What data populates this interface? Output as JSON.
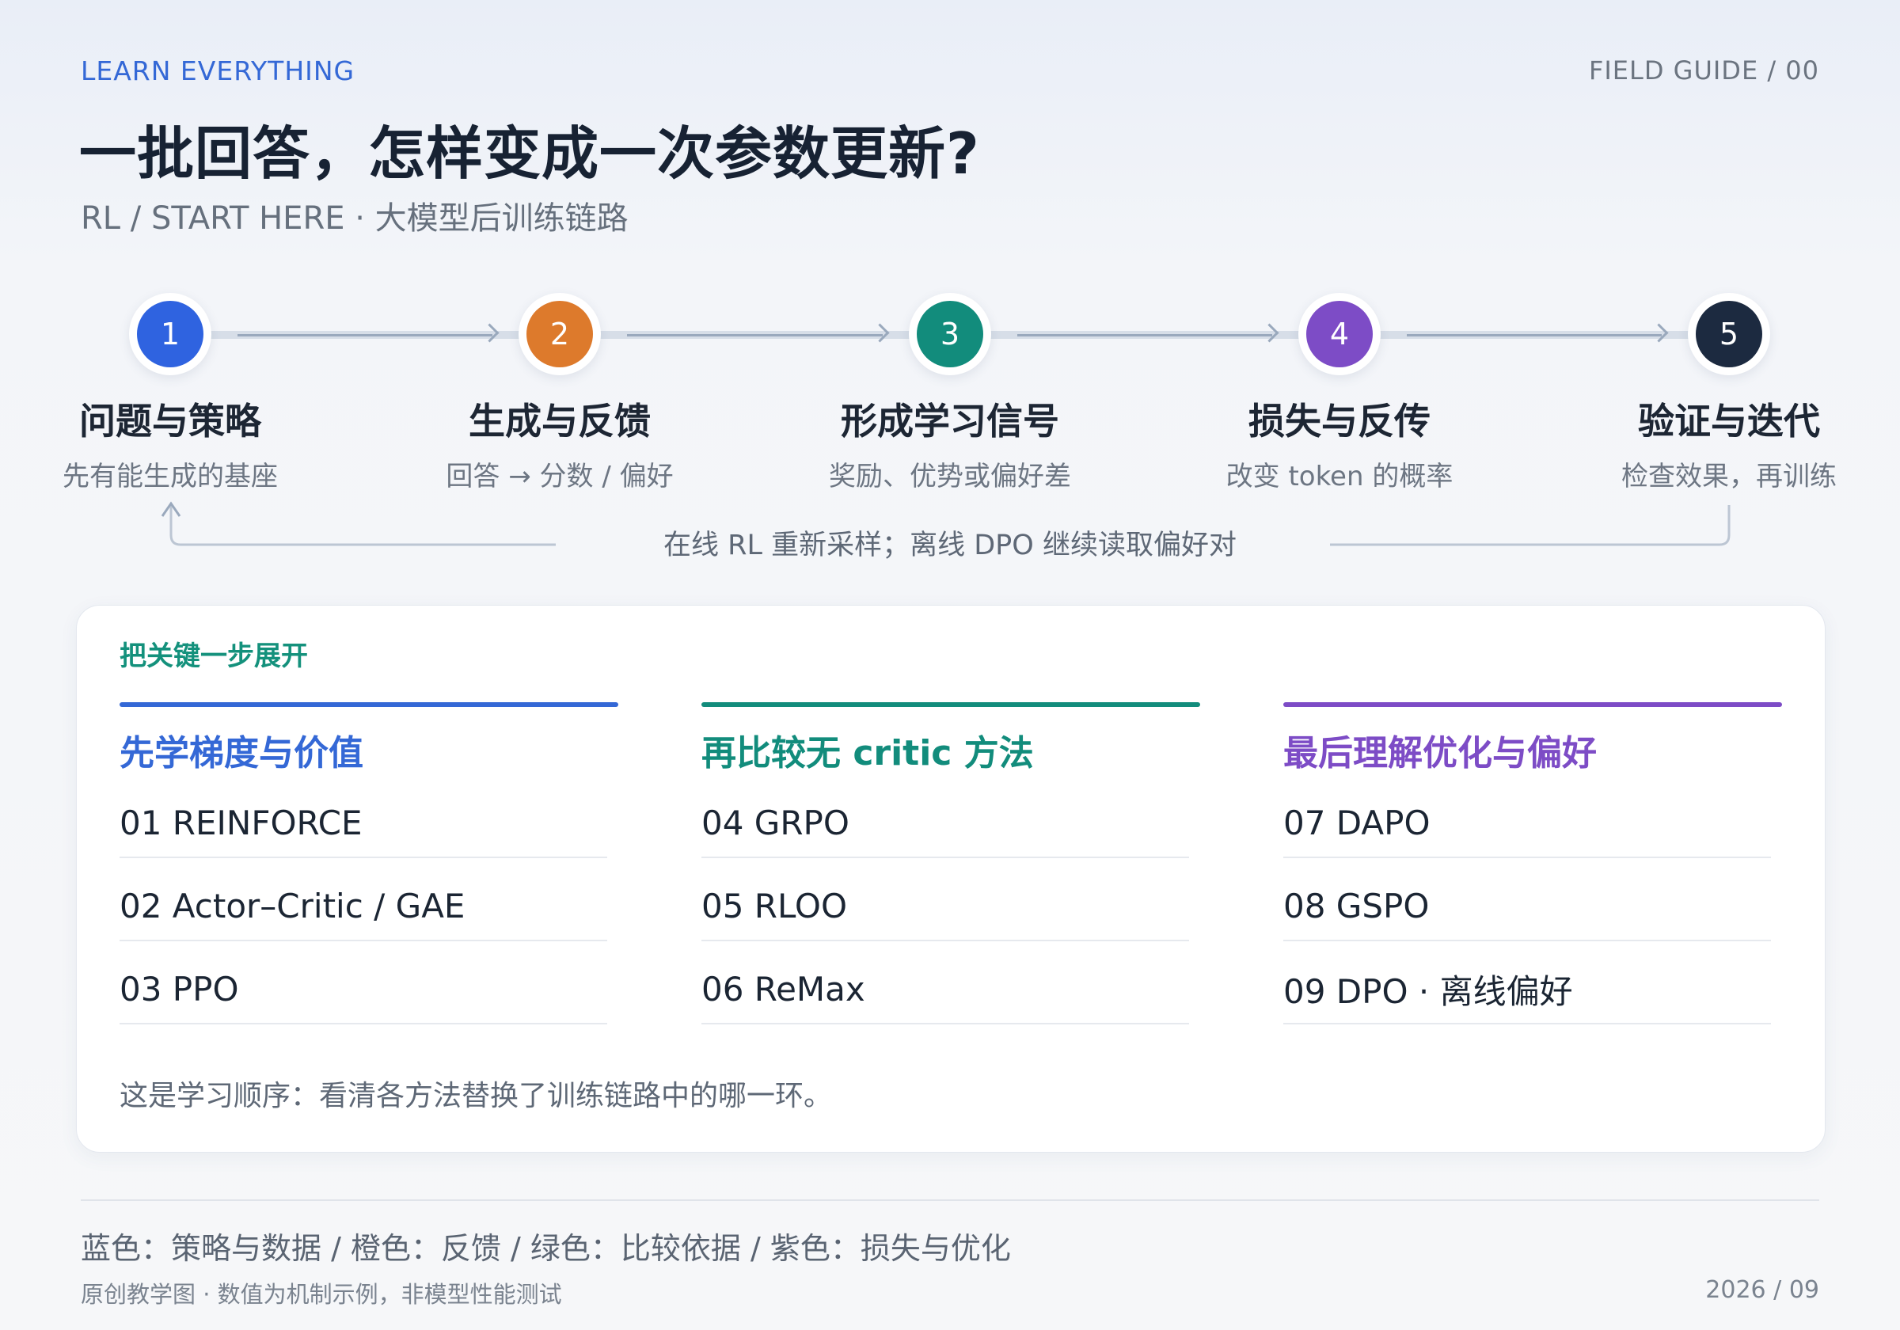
{
  "header": {
    "kicker": "LEARN EVERYTHING",
    "guide": "FIELD GUIDE / 00",
    "title": "一批回答，怎样变成一次参数更新?",
    "subtitle": "RL / START HERE · 大模型后训练链路"
  },
  "flow": {
    "steps": [
      {
        "num": "1",
        "title": "问题与策略",
        "sub": "先有能生成的基座",
        "color": "#2f63e0"
      },
      {
        "num": "2",
        "title": "生成与反馈",
        "sub": "回答 → 分数 / 偏好",
        "color": "#dd7a2c"
      },
      {
        "num": "3",
        "title": "形成学习信号",
        "sub": "奖励、优势或偏好差",
        "color": "#128c7c"
      },
      {
        "num": "4",
        "title": "损失与反传",
        "sub": "改变 token 的概率",
        "color": "#7d4cc6"
      },
      {
        "num": "5",
        "title": "验证与迭代",
        "sub": "检查效果，再训练",
        "color": "#1c2a40"
      }
    ],
    "loop_note": "在线 RL 重新采样；离线 DPO 继续读取偏好对"
  },
  "card": {
    "title": "把关键一步展开",
    "columns": [
      {
        "title": "先学梯度与价值",
        "color": "#3468d6",
        "items": [
          "01 REINFORCE",
          "02 Actor–Critic / GAE",
          "03 PPO"
        ]
      },
      {
        "title": "再比较无 critic 方法",
        "color": "#128c7c",
        "items": [
          "04 GRPO",
          "05 RLOO",
          "06 ReMax"
        ]
      },
      {
        "title": "最后理解优化与偏好",
        "color": "#7d4cc6",
        "items": [
          "07 DAPO",
          "08 GSPO",
          "09 DPO · 离线偏好"
        ]
      }
    ],
    "note": "这是学习顺序：看清各方法替换了训练链路中的哪一环。"
  },
  "footer": {
    "legend": "蓝色：策略与数据 / 橙色：反馈 / 绿色：比较依据 / 紫色：损失与优化",
    "credit": "原创教学图 · 数值为机制示例，非模型性能测试",
    "date": "2026 / 09"
  }
}
